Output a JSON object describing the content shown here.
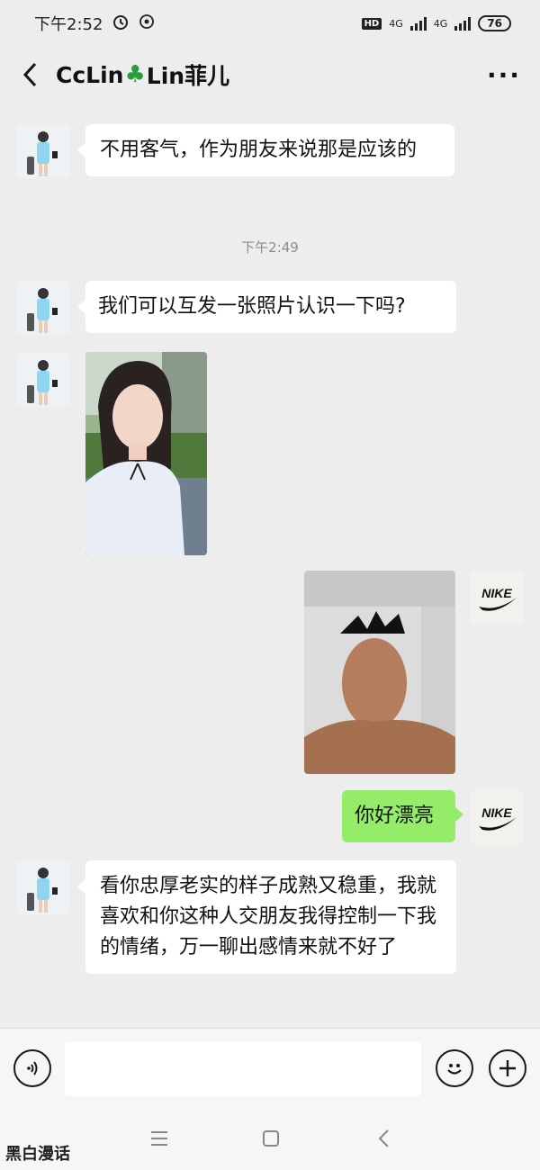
{
  "status": {
    "time": "下午2:52",
    "hd": "HD",
    "net1": "4G",
    "net2": "4G",
    "battery": "76"
  },
  "header": {
    "name_part1": "CcLin",
    "name_part2": "Lin菲儿"
  },
  "messages": {
    "m1": "不用客气，作为朋友来说那是应该的",
    "ts": "下午2:49",
    "m2": "我们可以互发一张照片认识一下吗?",
    "m3": "你好漂亮",
    "m4": "看你忠厚老实的样子成熟又稳重，我就喜欢和你这种人交朋友我得控制一下我的情绪，万一聊出感情来就不好了"
  },
  "self_avatar_text": "NIKE",
  "watermark": "黑白漫话",
  "colors": {
    "accent_green": "#95ec69",
    "bg": "#ededed"
  },
  "icons": [
    "back-icon",
    "more-icon",
    "voice-icon",
    "emoji-icon",
    "plus-icon",
    "menu-icon",
    "home-icon",
    "nav-back-icon",
    "alarm-icon"
  ]
}
